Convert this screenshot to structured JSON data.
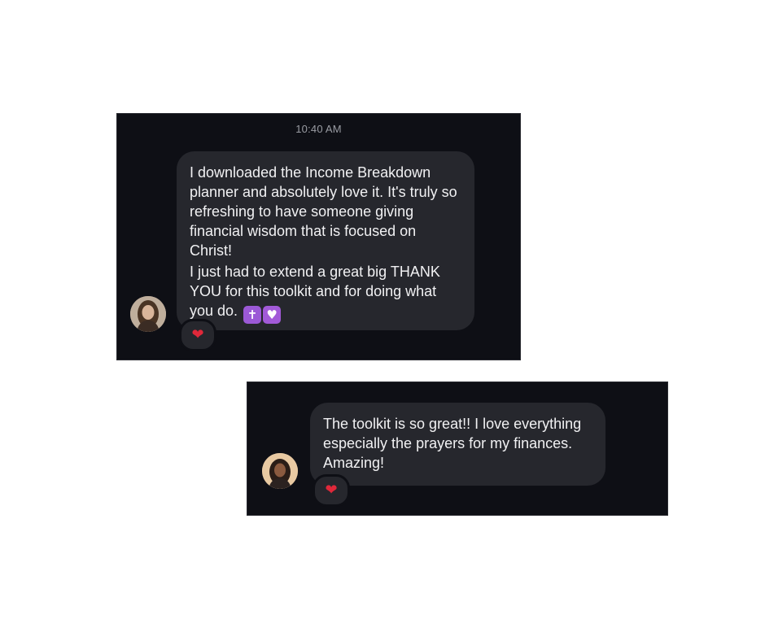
{
  "conversations": [
    {
      "timestamp": "10:40 AM",
      "message": {
        "paragraph_1": "I downloaded the Income Breakdown planner and absolutely love it. It's truly so refreshing to have someone giving financial wisdom that is focused on Christ!",
        "paragraph_2": "I just had to extend a great big THANK YOU for this toolkit and for doing what you do.",
        "emoji_1": "✝",
        "emoji_2": "♥"
      },
      "reaction": "❤",
      "avatar_icon": "woman-avatar-icon"
    },
    {
      "message": {
        "paragraph_1": "The toolkit is so great!! I love everything especially the prayers for my finances. Amazing!"
      },
      "reaction": "❤",
      "avatar_icon": "woman-avatar-icon"
    }
  ],
  "colors": {
    "panel_bg": "#0e0f15",
    "bubble_bg": "#26272d",
    "text": "#f1f1f3",
    "timestamp": "#9a9ca3",
    "reaction_heart": "#e0283a",
    "emoji_purple": "#9b59d6"
  }
}
